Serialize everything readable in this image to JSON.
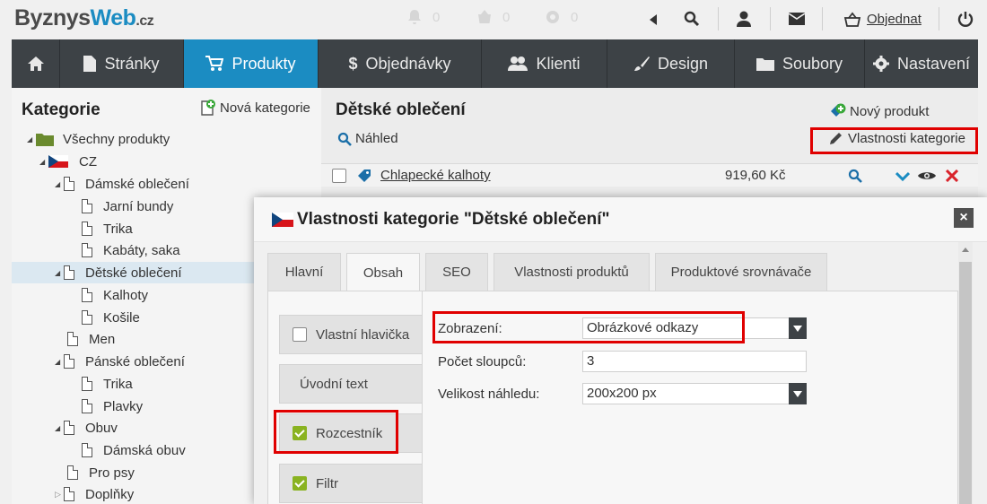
{
  "logo": {
    "part1": "Byznys",
    "part2": "Web",
    "part3": ".cz"
  },
  "topbar": {
    "notifications": "0",
    "cart_count": "0",
    "settings_count": "0",
    "order_link": "Objednat"
  },
  "nav": {
    "items": [
      {
        "label": "",
        "icon": "home-icon"
      },
      {
        "label": "Stránky",
        "icon": "page-icon"
      },
      {
        "label": "Produkty",
        "icon": "cart-icon"
      },
      {
        "label": "Objednávky",
        "icon": "dollar-icon"
      },
      {
        "label": "Klienti",
        "icon": "users-icon"
      },
      {
        "label": "Design",
        "icon": "brush-icon"
      },
      {
        "label": "Soubory",
        "icon": "folder-icon"
      },
      {
        "label": "Nastavení",
        "icon": "gear-icon"
      }
    ]
  },
  "left": {
    "title": "Kategorie",
    "new_category": "Nová kategorie",
    "tree": [
      {
        "label": "Všechny produkty"
      },
      {
        "label": "CZ"
      },
      {
        "label": "Dámské oblečení"
      },
      {
        "label": "Jarní bundy"
      },
      {
        "label": "Trika"
      },
      {
        "label": "Kabáty, saka"
      },
      {
        "label": "Dětské oblečení"
      },
      {
        "label": "Kalhoty"
      },
      {
        "label": "Košile"
      },
      {
        "label": "Men"
      },
      {
        "label": "Pánské oblečení"
      },
      {
        "label": "Trika"
      },
      {
        "label": "Plavky"
      },
      {
        "label": "Obuv"
      },
      {
        "label": "Dámská obuv"
      },
      {
        "label": "Pro psy"
      },
      {
        "label": "Doplňky"
      }
    ]
  },
  "main": {
    "title": "Dětské oblečení",
    "preview": "Náhled",
    "new_product": "Nový produkt",
    "category_properties": "Vlastnosti kategorie",
    "product": {
      "name": "Chlapecké kalhoty",
      "price": "919,60 Kč"
    }
  },
  "modal": {
    "title": "Vlastnosti kategorie \"Dětské oblečení\"",
    "close": "×",
    "tabs": [
      "Hlavní",
      "Obsah",
      "SEO",
      "Vlastnosti produktů",
      "Produktové srovnávače"
    ],
    "active_tab": "Obsah",
    "sections": [
      {
        "label": "Vlastní hlavička",
        "checked": false
      },
      {
        "label": "Úvodní text",
        "checked": null
      },
      {
        "label": "Rozcestník",
        "checked": true
      },
      {
        "label": "Filtr",
        "checked": true
      }
    ],
    "form": {
      "display_label": "Zobrazení:",
      "display_value": "Obrázkové odkazy",
      "columns_label": "Počet sloupců:",
      "columns_value": "3",
      "thumb_label": "Velikost náhledu:",
      "thumb_value": "200x200 px"
    }
  },
  "colors": {
    "accent": "#1b8cc2",
    "nav_bg": "#3d4246",
    "highlight": "#e00000",
    "check_green": "#8ab321"
  }
}
